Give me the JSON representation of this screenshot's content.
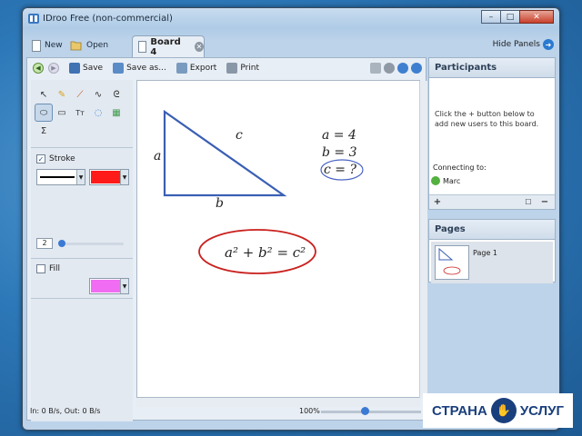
{
  "window": {
    "title": "IDroo Free (non-commercial)",
    "min": "–",
    "max": "□",
    "close": "✕"
  },
  "tabs": {
    "new_label": "New",
    "open_label": "Open",
    "board_label": "Board 4",
    "hide_panels_label": "Hide Panels"
  },
  "toolbar": {
    "save_label": "Save",
    "save_as_label": "Save as...",
    "export_label": "Export",
    "print_label": "Print"
  },
  "tools": {
    "items": [
      "↖",
      "✎",
      "⟋",
      "∿",
      "ᘓ",
      "⬭",
      "▭",
      "Tт",
      "◌",
      "▦",
      "Σ"
    ],
    "stroke_label": "Stroke",
    "stroke_checked": "✓",
    "stroke_color": "#ff1a1a",
    "stroke_width": "2",
    "fill_label": "Fill",
    "fill_color": "#f06cf2",
    "dropdown_arrow": "▼"
  },
  "canvas": {
    "label_a": "a",
    "label_b": "b",
    "label_c": "c",
    "eq1": "a = 4",
    "eq2": "b = 3",
    "eq3": "c = ?",
    "pythag": "a² + b² = c²"
  },
  "status": {
    "transfer": "In: 0 B/s, Out: 0 B/s",
    "zoom": "100%"
  },
  "participants": {
    "header": "Participants",
    "hint": "Click the + button below to add new users to this board.",
    "connecting_label": "Connecting to:",
    "user": "Marc",
    "add_btn": "+",
    "remove_btn": "−",
    "chat_btn": "☐"
  },
  "pages": {
    "header": "Pages",
    "page_label": "Page 1"
  },
  "logo": {
    "text_left": "СТРАНА",
    "text_right": "УСЛУГ",
    "badge": "✋"
  }
}
